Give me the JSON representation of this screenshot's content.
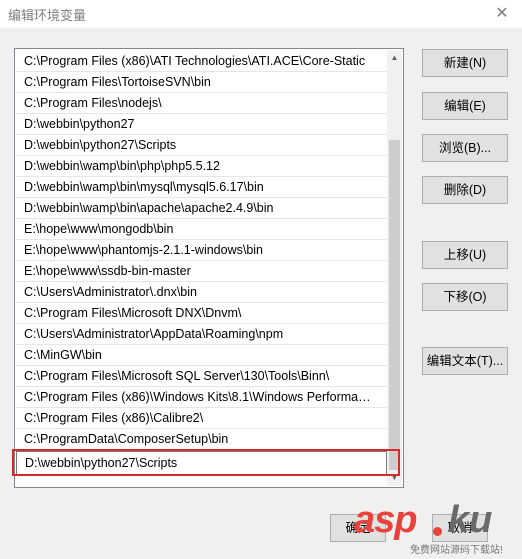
{
  "window": {
    "title": "编辑环境变量",
    "close_glyph": "✕"
  },
  "paths": [
    "C:\\Program Files (x86)\\ATI Technologies\\ATI.ACE\\Core-Static",
    "C:\\Program Files\\TortoiseSVN\\bin",
    "C:\\Program Files\\nodejs\\",
    "D:\\webbin\\python27",
    "D:\\webbin\\python27\\Scripts",
    "D:\\webbin\\wamp\\bin\\php\\php5.5.12",
    "D:\\webbin\\wamp\\bin\\mysql\\mysql5.6.17\\bin",
    "D:\\webbin\\wamp\\bin\\apache\\apache2.4.9\\bin",
    "E:\\hope\\www\\mongodb\\bin",
    "E:\\hope\\www\\phantomjs-2.1.1-windows\\bin",
    "E:\\hope\\www\\ssdb-bin-master",
    "C:\\Users\\Administrator\\.dnx\\bin",
    "C:\\Program Files\\Microsoft DNX\\Dnvm\\",
    "C:\\Users\\Administrator\\AppData\\Roaming\\npm",
    "C:\\MinGW\\bin",
    "C:\\Program Files\\Microsoft SQL Server\\130\\Tools\\Binn\\",
    "C:\\Program Files (x86)\\Windows Kits\\8.1\\Windows Performa…",
    "C:\\Program Files (x86)\\Calibre2\\",
    "C:\\ProgramData\\ComposerSetup\\bin"
  ],
  "editing_path": "D:\\webbin\\python27\\Scripts",
  "buttons": {
    "new": "新建(N)",
    "edit": "编辑(E)",
    "browse": "浏览(B)...",
    "delete": "删除(D)",
    "move_up": "上移(U)",
    "move_down": "下移(O)",
    "edit_text": "编辑文本(T)...",
    "ok": "确定",
    "cancel": "取消"
  },
  "watermark": {
    "asp": "asp",
    "ku": "ku",
    "sub": "免费网站源码下载站!"
  }
}
